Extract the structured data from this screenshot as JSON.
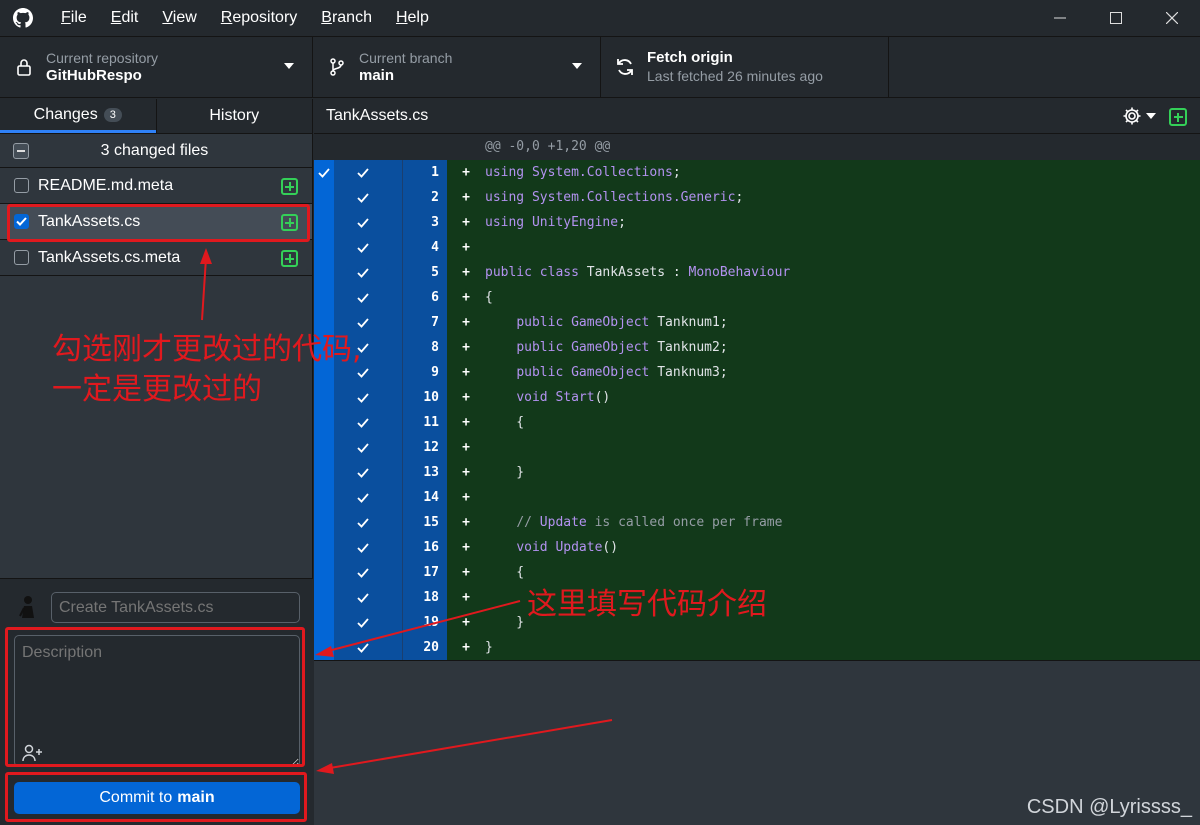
{
  "menu": [
    {
      "label": "File",
      "accel": "F",
      "rest": "ile"
    },
    {
      "label": "Edit",
      "accel": "E",
      "rest": "dit"
    },
    {
      "label": "View",
      "accel": "V",
      "rest": "iew"
    },
    {
      "label": "Repository",
      "accel": "R",
      "rest": "epository"
    },
    {
      "label": "Branch",
      "accel": "B",
      "rest": "ranch"
    },
    {
      "label": "Help",
      "accel": "H",
      "rest": "elp"
    }
  ],
  "toolbar": {
    "repo_label": "Current repository",
    "repo_value": "GitHubRespo",
    "branch_label": "Current branch",
    "branch_value": "main",
    "fetch_title": "Fetch origin",
    "fetch_sub": "Last fetched 26 minutes ago"
  },
  "tabs": {
    "changes": "Changes",
    "changes_count": "3",
    "history": "History"
  },
  "changes": {
    "header": "3 changed files",
    "files": [
      {
        "name": "README.md.meta",
        "checked": false
      },
      {
        "name": "TankAssets.cs",
        "checked": true
      },
      {
        "name": "TankAssets.cs.meta",
        "checked": false
      }
    ]
  },
  "commit": {
    "summary_placeholder": "Create TankAssets.cs",
    "description_placeholder": "Description",
    "button_prefix": "Commit to",
    "button_branch": "main"
  },
  "diff": {
    "file": "TankAssets.cs",
    "hunk": "@@ -0,0 +1,20 @@",
    "lines": [
      {
        "n": "1",
        "code": "using System.Collections;"
      },
      {
        "n": "2",
        "code": "using System.Collections.Generic;"
      },
      {
        "n": "3",
        "code": "using UnityEngine;"
      },
      {
        "n": "4",
        "code": ""
      },
      {
        "n": "5",
        "code": "public class TankAssets : MonoBehaviour"
      },
      {
        "n": "6",
        "code": "{"
      },
      {
        "n": "7",
        "code": "    public GameObject Tanknum1;"
      },
      {
        "n": "8",
        "code": "    public GameObject Tanknum2;"
      },
      {
        "n": "9",
        "code": "    public GameObject Tanknum3;"
      },
      {
        "n": "10",
        "code": "    void Start()"
      },
      {
        "n": "11",
        "code": "    {"
      },
      {
        "n": "12",
        "code": ""
      },
      {
        "n": "13",
        "code": "    }"
      },
      {
        "n": "14",
        "code": ""
      },
      {
        "n": "15",
        "code": "    // Update is called once per frame"
      },
      {
        "n": "16",
        "code": "    void Update()"
      },
      {
        "n": "17",
        "code": "    {"
      },
      {
        "n": "18",
        "code": ""
      },
      {
        "n": "19",
        "code": "    }"
      },
      {
        "n": "20",
        "code": "}"
      }
    ]
  },
  "annotations": {
    "select_note_line1": "勾选刚才更改过的代码,",
    "select_note_line2": "一定是更改过的",
    "desc_note": "这里填写代码介绍"
  },
  "watermark": "CSDN @Lyrissss_",
  "colors": {
    "accent": "#0366d6",
    "added_bg": "#12391a",
    "added_icon": "#34d058",
    "annotation": "#e0191e"
  }
}
